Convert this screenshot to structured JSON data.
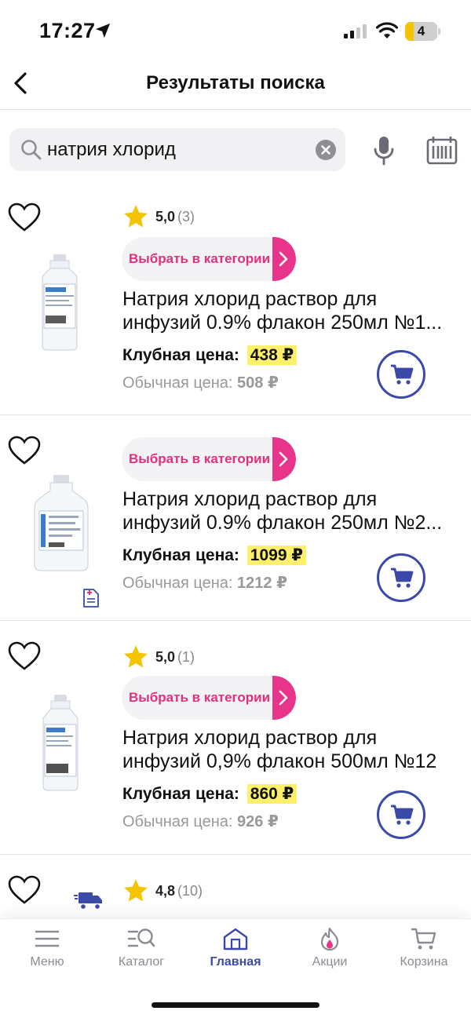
{
  "status_bar": {
    "time": "17:27",
    "battery": "4"
  },
  "header": {
    "title": "Результаты поиска"
  },
  "search": {
    "query": "натрия хлорид"
  },
  "products": [
    {
      "rating": "5,0",
      "rating_count": "(3)",
      "category_label": "Выбрать в категории",
      "title": "Натрия хлорид раствор для",
      "title_line2": "инфузий 0.9% флакон 250мл №1...",
      "club_label": "Клубная цена:",
      "club_price": "438 ₽",
      "regular_label": "Обычная цена:",
      "regular_price": "508 ₽"
    },
    {
      "category_label": "Выбрать в категории",
      "title": "Натрия хлорид раствор для",
      "title_line2": "инфузий 0.9% флакон 250мл №2...",
      "club_label": "Клубная цена:",
      "club_price": "1099 ₽",
      "regular_label": "Обычная цена:",
      "regular_price": "1212 ₽"
    },
    {
      "rating": "5,0",
      "rating_count": "(1)",
      "category_label": "Выбрать в категории",
      "title": "Натрия хлорид раствор для",
      "title_line2": "инфузий 0,9% флакон 500мл №12",
      "club_label": "Клубная цена:",
      "club_price": "860 ₽",
      "regular_label": "Обычная цена:",
      "regular_price": "926 ₽"
    },
    {
      "rating": "4,8",
      "rating_count": "(10)"
    }
  ],
  "tabs": [
    {
      "label": "Меню",
      "icon": "menu-icon"
    },
    {
      "label": "Каталог",
      "icon": "catalog-search-icon"
    },
    {
      "label": "Главная",
      "icon": "home-icon",
      "active": true
    },
    {
      "label": "Акции",
      "icon": "flame-icon"
    },
    {
      "label": "Корзина",
      "icon": "basket-icon"
    }
  ],
  "colors": {
    "accent": "#e8348a",
    "primary": "#3b4aa8",
    "highlight": "#fff06b",
    "star": "#f5c400"
  }
}
